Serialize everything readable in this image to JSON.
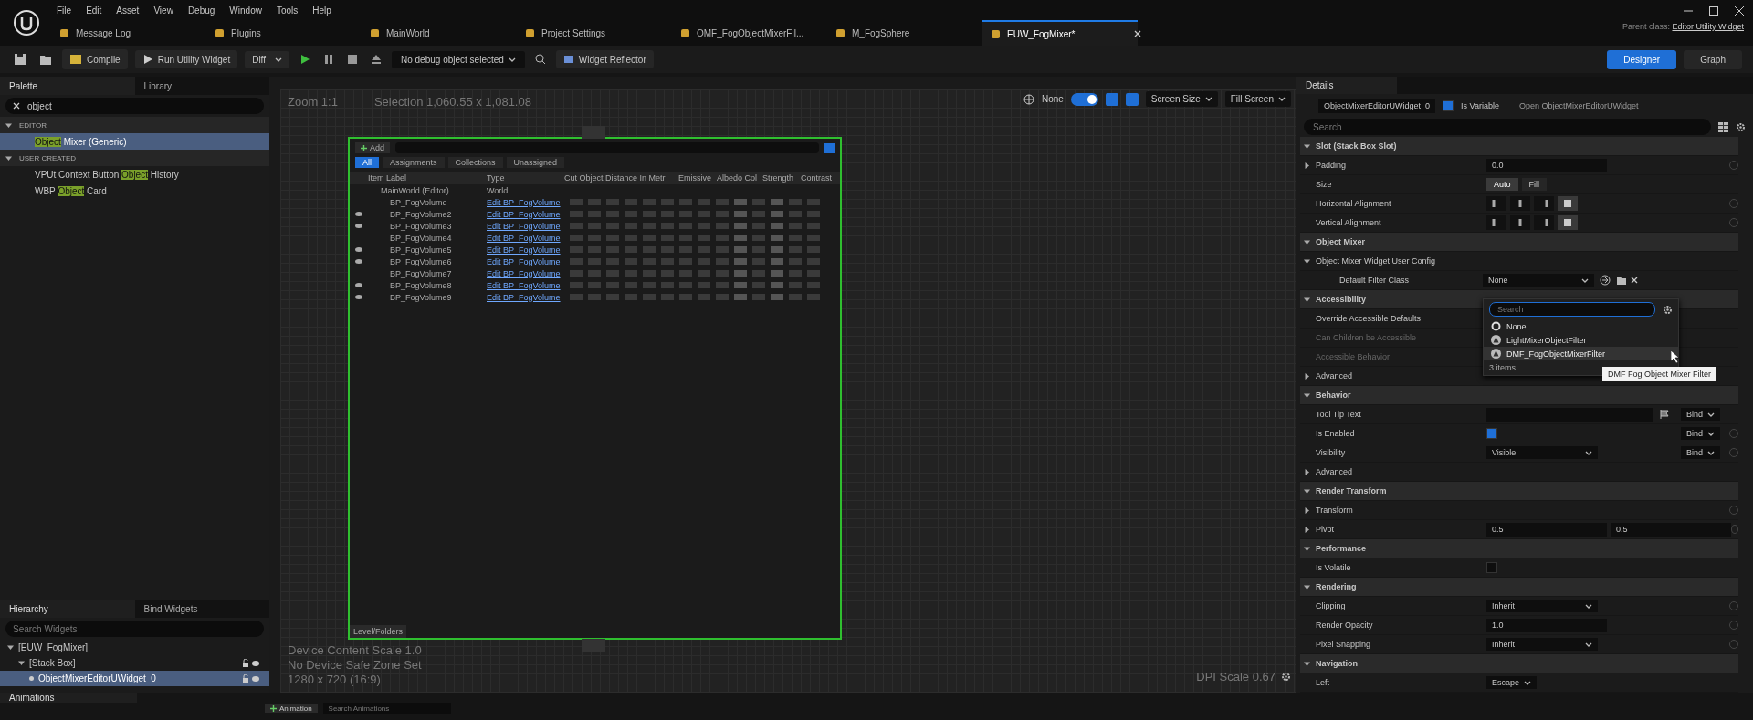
{
  "menu": [
    "File",
    "Edit",
    "Asset",
    "View",
    "Debug",
    "Window",
    "Tools",
    "Help"
  ],
  "doc_tabs": [
    {
      "label": "Message Log",
      "selected": false
    },
    {
      "label": "Plugins",
      "selected": false
    },
    {
      "label": "MainWorld",
      "selected": false
    },
    {
      "label": "Project Settings",
      "selected": false
    },
    {
      "label": "OMF_FogObjectMixerFil...",
      "selected": false
    },
    {
      "label": "M_FogSphere",
      "selected": false
    },
    {
      "label": "EUW_FogMixer*",
      "selected": true
    }
  ],
  "parent_class": {
    "label": "Parent class:",
    "value": "Editor Utility Widget"
  },
  "toolbar": {
    "compile": "Compile",
    "run": "Run Utility Widget",
    "diff": "Diff",
    "debug": "No debug object selected",
    "reflector": "Widget Reflector",
    "modes": [
      {
        "label": "Designer",
        "selected": true
      },
      {
        "label": "Graph",
        "selected": false
      }
    ]
  },
  "palette": {
    "tabs": [
      {
        "label": "Palette",
        "selected": true
      },
      {
        "label": "Library",
        "selected": false
      }
    ],
    "search": "object",
    "categories": [
      {
        "name": "EDITOR",
        "expanded": true,
        "items": [
          {
            "match": "Object",
            "after": " Mixer (Generic)",
            "selected": true
          }
        ]
      },
      {
        "name": "USER CREATED",
        "expanded": true,
        "items": [
          {
            "before": "VPUt Context Button ",
            "match": "Object",
            "after": " History",
            "selected": false
          },
          {
            "before": "WBP ",
            "match": "Object",
            "after": " Card",
            "selected": false
          }
        ]
      }
    ]
  },
  "hierarchy": {
    "tabs": [
      {
        "label": "Hierarchy",
        "selected": true
      },
      {
        "label": "Bind Widgets",
        "selected": false
      }
    ],
    "placeholder": "Search Widgets",
    "tree": [
      {
        "label": "[EUW_FogMixer]",
        "selected": false,
        "expanded": true,
        "children": [
          {
            "label": "[Stack Box]",
            "selected": false,
            "expanded": true,
            "children": [
              {
                "label": "ObjectMixerEditorUWidget_0",
                "selected": true
              }
            ]
          }
        ]
      }
    ]
  },
  "canvas": {
    "lock_toggle": {
      "on": true
    },
    "zoom": "Zoom 1:1",
    "selection": "Selection 1,060.55 x 1,081.08",
    "none": "None",
    "screen_size": "Screen Size",
    "fill": "Fill Screen",
    "info": [
      "Device Content Scale 1.0",
      "No Device Safe Zone Set",
      "1280 x 720 (16:9)"
    ],
    "dpi": "DPI Scale 0.67"
  },
  "preview": {
    "add": "Add",
    "filters": [
      {
        "label": "All",
        "selected": true
      },
      {
        "label": "Assignments",
        "selected": false
      },
      {
        "label": "Collections",
        "selected": false
      },
      {
        "label": "Unassigned",
        "selected": false
      }
    ],
    "columns": [
      "Item Label",
      "Type",
      "Cut Object Distance In Metr",
      "Emissive",
      "Albedo Col",
      "Strength",
      "Contrast"
    ],
    "rows": [
      {
        "label": "MainWorld (Editor)",
        "type": "World",
        "link": false,
        "visible": false
      },
      {
        "label": "BP_FogVolume",
        "type": "Edit BP_FogVolume",
        "link": true,
        "visible": false
      },
      {
        "label": "BP_FogVolume2",
        "type": "Edit BP_FogVolume",
        "link": true,
        "visible": true
      },
      {
        "label": "BP_FogVolume3",
        "type": "Edit BP_FogVolume",
        "link": true,
        "visible": true
      },
      {
        "label": "BP_FogVolume4",
        "type": "Edit BP_FogVolume",
        "link": true,
        "visible": false
      },
      {
        "label": "BP_FogVolume5",
        "type": "Edit BP_FogVolume",
        "link": true,
        "visible": true
      },
      {
        "label": "BP_FogVolume6",
        "type": "Edit BP_FogVolume",
        "link": true,
        "visible": true
      },
      {
        "label": "BP_FogVolume7",
        "type": "Edit BP_FogVolume",
        "link": true,
        "visible": false
      },
      {
        "label": "BP_FogVolume8",
        "type": "Edit BP_FogVolume",
        "link": true,
        "visible": true
      },
      {
        "label": "BP_FogVolume9",
        "type": "Edit BP_FogVolume",
        "link": true,
        "visible": true
      }
    ],
    "footer": "Level/Folders"
  },
  "details": {
    "tab": "Details",
    "widget_name": "ObjectMixerEditorUWidget_0",
    "is_variable": {
      "label": "Is Variable",
      "checked": true
    },
    "open_link": "Open ObjectMixerEditorUWidget",
    "placeholder": "Search",
    "rows": [
      {
        "kind": "section",
        "label": "Slot (Stack Box Slot)",
        "expanded": true
      },
      {
        "kind": "prop",
        "label": "Padding",
        "expanded": false,
        "value": {
          "kind": "field",
          "text": "0.0"
        },
        "reset": true
      },
      {
        "kind": "prop",
        "label": "Size",
        "value": {
          "kind": "segmented",
          "options": [
            {
              "label": "Auto",
              "selected": true
            },
            {
              "label": "Fill",
              "selected": false
            }
          ]
        },
        "reset": false
      },
      {
        "kind": "prop",
        "label": "Horizontal Alignment",
        "value": {
          "kind": "align",
          "options": [
            {
              "selected": false
            },
            {
              "selected": false
            },
            {
              "selected": false
            },
            {
              "selected": true
            }
          ]
        },
        "reset": true
      },
      {
        "kind": "prop",
        "label": "Vertical Alignment",
        "value": {
          "kind": "align",
          "options": [
            {
              "selected": false
            },
            {
              "selected": false
            },
            {
              "selected": false
            },
            {
              "selected": true
            }
          ]
        },
        "reset": true
      },
      {
        "kind": "section",
        "label": "Object Mixer",
        "expanded": true
      },
      {
        "kind": "group",
        "label": "Object Mixer Widget User Config",
        "expanded": true,
        "reset": false,
        "children": [
          {
            "kind": "prop",
            "label": "Default Filter Class",
            "value": {
              "kind": "asset",
              "text": "None"
            },
            "reset": false
          }
        ]
      },
      {
        "kind": "section",
        "label": "Accessibility",
        "expanded": true
      },
      {
        "kind": "prop",
        "label": "Override Accessible Defaults",
        "reset": false
      },
      {
        "kind": "prop",
        "label": "Can Children be Accessible",
        "disabled": true,
        "reset": false
      },
      {
        "kind": "prop",
        "label": "Accessible Behavior",
        "disabled": true,
        "reset": false
      },
      {
        "kind": "group",
        "label": "Advanced",
        "expanded": false,
        "reset": false
      },
      {
        "kind": "section",
        "label": "Behavior",
        "expanded": true
      },
      {
        "kind": "prop",
        "label": "Tool Tip Text",
        "value": {
          "kind": "text"
        },
        "bind": "Bind",
        "reset": false
      },
      {
        "kind": "prop",
        "label": "Is Enabled",
        "value": {
          "kind": "checkbox",
          "checked": true
        },
        "bind": "Bind",
        "reset": true
      },
      {
        "kind": "prop",
        "label": "Visibility",
        "value": {
          "kind": "dropdown",
          "text": "Visible"
        },
        "bind": "Bind",
        "reset": true
      },
      {
        "kind": "group",
        "label": "Advanced",
        "expanded": false,
        "reset": false
      },
      {
        "kind": "section",
        "label": "Render Transform",
        "expanded": true
      },
      {
        "kind": "group",
        "label": "Transform",
        "expanded": false,
        "reset": true
      },
      {
        "kind": "prop",
        "label": "Pivot",
        "expanded": false,
        "value": {
          "kind": "pair",
          "values": [
            "0.5",
            "0.5"
          ]
        },
        "reset": true
      },
      {
        "kind": "section",
        "label": "Performance",
        "expanded": true
      },
      {
        "kind": "prop",
        "label": "Is Volatile",
        "value": {
          "kind": "checkbox",
          "checked": false
        },
        "reset": false
      },
      {
        "kind": "section",
        "label": "Rendering",
        "expanded": true
      },
      {
        "kind": "prop",
        "label": "Clipping",
        "value": {
          "kind": "dropdown",
          "text": "Inherit"
        },
        "reset": true
      },
      {
        "kind": "prop",
        "label": "Render Opacity",
        "value": {
          "kind": "field",
          "text": "1.0"
        },
        "reset": true
      },
      {
        "kind": "prop",
        "label": "Pixel Snapping",
        "value": {
          "kind": "dropdown",
          "text": "Inherit"
        },
        "reset": true
      },
      {
        "kind": "section",
        "label": "Navigation",
        "expanded": true
      },
      {
        "kind": "prop",
        "label": "Left",
        "value": {
          "kind": "small-dropdown",
          "text": "Escape"
        },
        "reset": false
      }
    ],
    "popup": {
      "placeholder": "Search",
      "options": [
        {
          "label": "None",
          "kind": "none",
          "highlighted": false
        },
        {
          "label": "LightMixerObjectFilter",
          "kind": "class",
          "highlighted": false
        },
        {
          "label": "DMF_FogObjectMixerFilter",
          "kind": "class",
          "highlighted": true
        }
      ],
      "count": "3 items",
      "tooltip": "DMF Fog Object Mixer Filter"
    }
  },
  "animations": {
    "tab": "Animations",
    "add": "Animation",
    "placeholder": "Search Animations"
  }
}
